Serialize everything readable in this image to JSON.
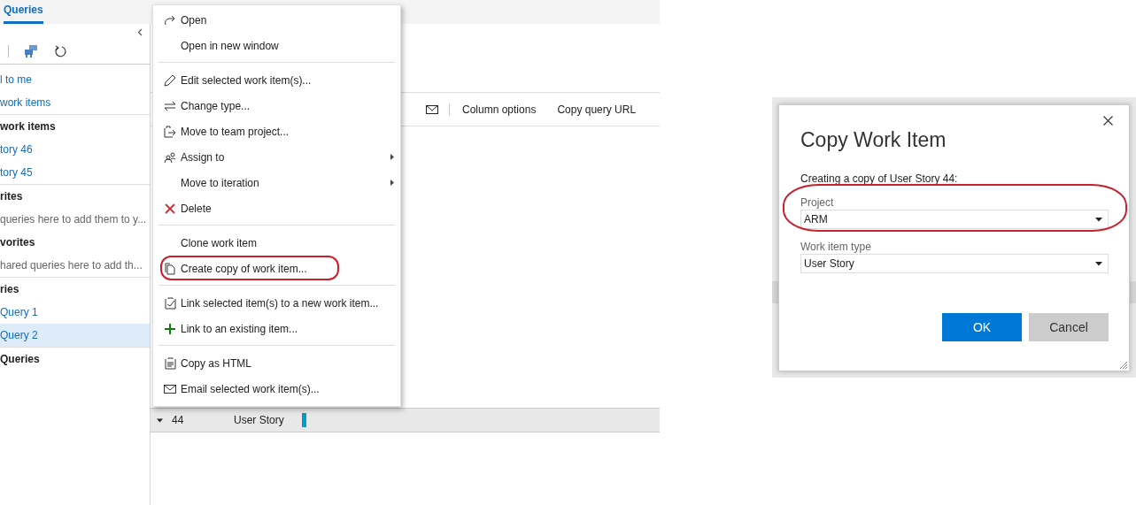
{
  "tabs": [
    {
      "label": "Queries",
      "selected": true
    }
  ],
  "sidebar": {
    "items": [
      {
        "kind": "link",
        "label": "l to me",
        "selected": false
      },
      {
        "kind": "link",
        "label": "work items",
        "selected": false
      },
      {
        "kind": "header",
        "label": "work items",
        "selected": false
      },
      {
        "kind": "link",
        "label": "tory 46",
        "selected": false
      },
      {
        "kind": "link",
        "label": "tory 45",
        "selected": false
      },
      {
        "kind": "header",
        "label": "rites",
        "selected": false
      },
      {
        "kind": "hint",
        "label": "queries here to add them to y...",
        "selected": false
      },
      {
        "kind": "header",
        "label": "vorites",
        "selected": false
      },
      {
        "kind": "hint",
        "label": "hared queries here to add th...",
        "selected": false
      },
      {
        "kind": "header",
        "label": "ries",
        "selected": false
      },
      {
        "kind": "link",
        "label": "Query 1",
        "selected": false
      },
      {
        "kind": "link",
        "label": "Query 2",
        "selected": true
      },
      {
        "kind": "header",
        "label": "Queries",
        "selected": false
      }
    ]
  },
  "toolbar": {
    "items": [
      "Column options",
      "Copy query URL"
    ]
  },
  "results": {
    "rows": [
      {
        "id": "44",
        "type": "User Story",
        "expanded": true,
        "color": "#009ccc"
      }
    ]
  },
  "context_menu": {
    "groups": [
      [
        {
          "label": "Open",
          "submenu": false,
          "highlighted": false
        },
        {
          "label": "Open in new window",
          "submenu": false,
          "highlighted": false
        }
      ],
      [
        {
          "label": "Edit selected work item(s)...",
          "submenu": false,
          "highlighted": false
        },
        {
          "label": "Change type...",
          "submenu": false,
          "highlighted": false
        },
        {
          "label": "Move to team project...",
          "submenu": false,
          "highlighted": false
        },
        {
          "label": "Assign to",
          "submenu": true,
          "highlighted": false
        },
        {
          "label": "Move to iteration",
          "submenu": true,
          "highlighted": false
        },
        {
          "label": "Delete",
          "submenu": false,
          "highlighted": false
        }
      ],
      [
        {
          "label": "Clone work item",
          "submenu": false,
          "highlighted": false
        },
        {
          "label": "Create copy of work item...",
          "submenu": false,
          "highlighted": true
        }
      ],
      [
        {
          "label": "Link selected item(s) to a new work item...",
          "submenu": false,
          "highlighted": false
        },
        {
          "label": "Link to an existing item...",
          "submenu": false,
          "highlighted": false
        }
      ],
      [
        {
          "label": "Copy as HTML",
          "submenu": false,
          "highlighted": false
        },
        {
          "label": "Email selected work item(s)...",
          "submenu": false,
          "highlighted": false
        }
      ]
    ]
  },
  "dialog": {
    "title": "Copy Work Item",
    "description": "Creating a copy of User Story 44:",
    "fields": [
      {
        "label": "Project",
        "value": "ARM",
        "highlighted": true
      },
      {
        "label": "Work item type",
        "value": "User Story",
        "highlighted": false
      }
    ],
    "buttons": [
      {
        "label": "OK",
        "kind": "primary"
      },
      {
        "label": "Cancel",
        "kind": "secondary"
      }
    ]
  }
}
